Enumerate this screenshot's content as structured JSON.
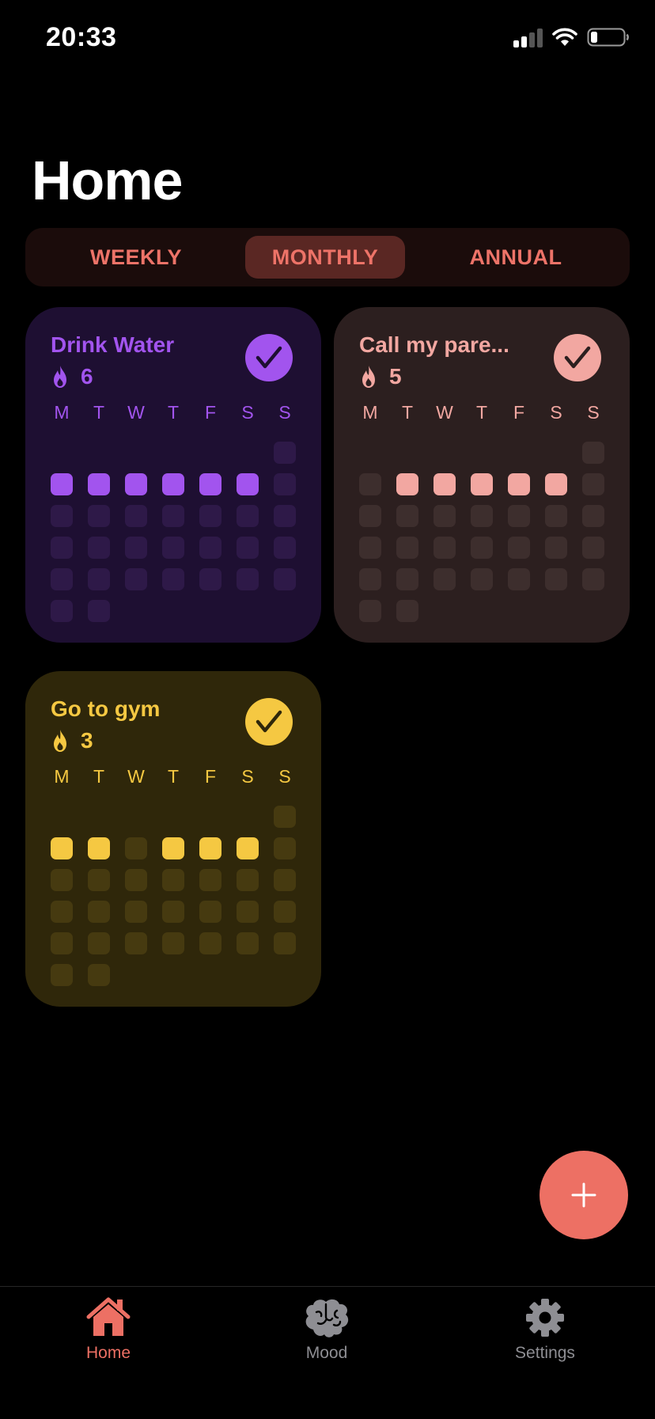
{
  "status": {
    "time": "20:33"
  },
  "title": "Home",
  "segments": [
    {
      "label": "WEEKLY",
      "active": false
    },
    {
      "label": "MONTHLY",
      "active": true
    },
    {
      "label": "ANNUAL",
      "active": false
    }
  ],
  "weekday_labels": [
    "M",
    "T",
    "W",
    "T",
    "F",
    "S",
    "S"
  ],
  "habits": [
    {
      "name": "Drink Water",
      "streak": "6",
      "done_today": true,
      "colors": {
        "card_bg": "#1e0f32",
        "accent": "#a254ee",
        "empty_cell": "#2e1948",
        "check_icon": "#1e0f32"
      },
      "weeks": [
        [
          null,
          null,
          null,
          null,
          null,
          null,
          0
        ],
        [
          1,
          1,
          1,
          1,
          1,
          1,
          0
        ],
        [
          0,
          0,
          0,
          0,
          0,
          0,
          0
        ],
        [
          0,
          0,
          0,
          0,
          0,
          0,
          0
        ],
        [
          0,
          0,
          0,
          0,
          0,
          0,
          0
        ],
        [
          0,
          0,
          null,
          null,
          null,
          null,
          null
        ]
      ]
    },
    {
      "name": "Call my pare...",
      "streak": "5",
      "done_today": true,
      "colors": {
        "card_bg": "#2c1f1f",
        "accent": "#f2a7a1",
        "empty_cell": "#3d2e2d",
        "check_icon": "#2c1f1f"
      },
      "weeks": [
        [
          null,
          null,
          null,
          null,
          null,
          null,
          0
        ],
        [
          0,
          1,
          1,
          1,
          1,
          1,
          0
        ],
        [
          0,
          0,
          0,
          0,
          0,
          0,
          0
        ],
        [
          0,
          0,
          0,
          0,
          0,
          0,
          0
        ],
        [
          0,
          0,
          0,
          0,
          0,
          0,
          0
        ],
        [
          0,
          0,
          null,
          null,
          null,
          null,
          null
        ]
      ]
    },
    {
      "name": "Go to gym",
      "streak": "3",
      "done_today": true,
      "colors": {
        "card_bg": "#2f270a",
        "accent": "#f5c842",
        "empty_cell": "#463a10",
        "check_icon": "#2f270a"
      },
      "weeks": [
        [
          null,
          null,
          null,
          null,
          null,
          null,
          0
        ],
        [
          1,
          1,
          0,
          1,
          1,
          1,
          0
        ],
        [
          0,
          0,
          0,
          0,
          0,
          0,
          0
        ],
        [
          0,
          0,
          0,
          0,
          0,
          0,
          0
        ],
        [
          0,
          0,
          0,
          0,
          0,
          0,
          0
        ],
        [
          0,
          0,
          null,
          null,
          null,
          null,
          null
        ]
      ]
    }
  ],
  "fab": {
    "icon": "plus-icon"
  },
  "tabs": [
    {
      "label": "Home",
      "icon": "home-icon",
      "active": true
    },
    {
      "label": "Mood",
      "icon": "brain-icon",
      "active": false
    },
    {
      "label": "Settings",
      "icon": "gear-icon",
      "active": false
    }
  ],
  "colors": {
    "accent": "#ed7064",
    "tab_inactive": "#8e8e93",
    "background": "#000000"
  }
}
